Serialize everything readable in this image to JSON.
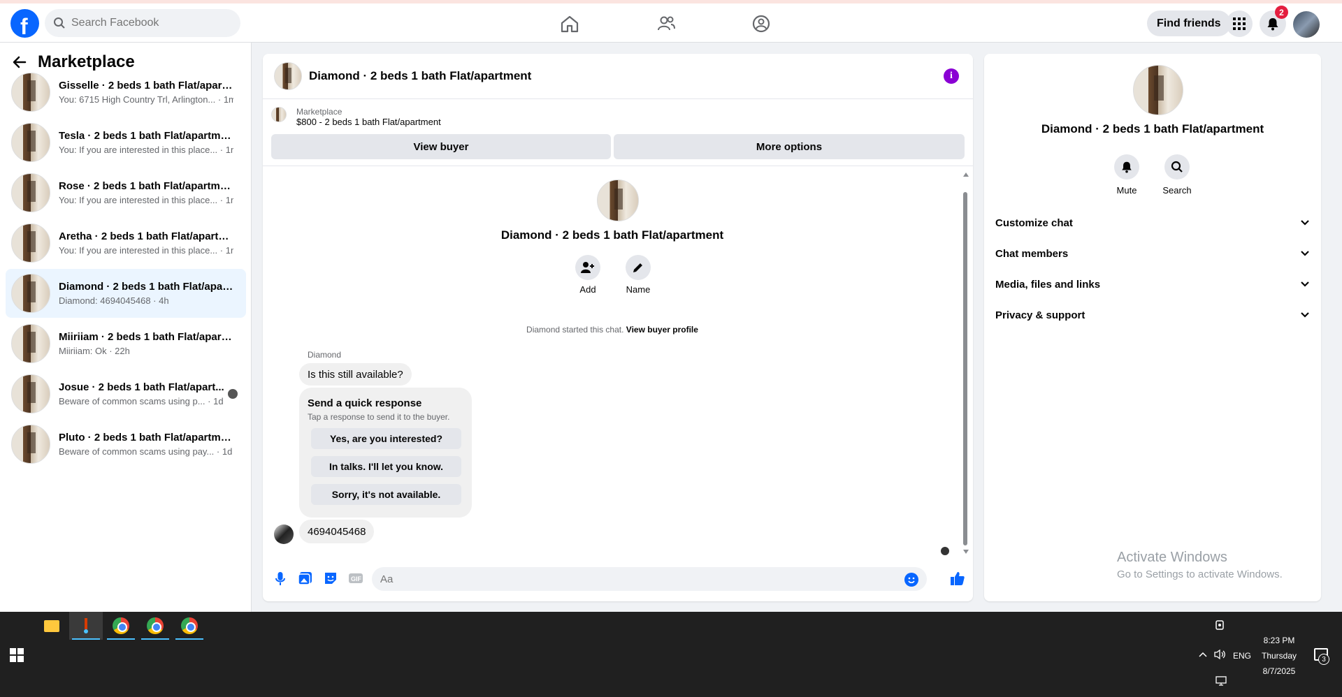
{
  "topbar": {
    "search_placeholder": "Search Facebook",
    "find_friends_label": "Find friends",
    "notifications_count": "2"
  },
  "sidebar": {
    "title": "Marketplace",
    "conversations": [
      {
        "title": "Gisselle · 2 beds 1 bath Flat/apart...",
        "subtitle": "You: 6715 High Country Trl, Arlington... · 1m"
      },
      {
        "title": "Tesla · 2 beds 1 bath Flat/apartment",
        "subtitle": "You: If you are interested in this place... · 1m"
      },
      {
        "title": "Rose · 2 beds 1 bath Flat/apartment",
        "subtitle": "You: If you are interested in this place... · 1m"
      },
      {
        "title": "Aretha · 2 beds 1 bath Flat/apartm...",
        "subtitle": "You: If you are interested in this place... · 1m"
      },
      {
        "title": "Diamond · 2 beds 1 bath Flat/apart...",
        "subtitle": "Diamond: 4694045468 · 4h"
      },
      {
        "title": "Miiriiam · 2 beds 1 bath Flat/apart...",
        "subtitle": "Miiriiam: Ok · 22h"
      },
      {
        "title": "Josue · 2 beds 1 bath Flat/apart...",
        "subtitle": "Beware of common scams using p... · 1d"
      },
      {
        "title": "Pluto · 2 beds 1 bath Flat/apartment",
        "subtitle": "Beware of common scams using pay... · 1d"
      }
    ]
  },
  "chat": {
    "title": "Diamond · 2 beds 1 bath Flat/apartment",
    "marketplace_label": "Marketplace",
    "listing": "$800 - 2 beds 1 bath Flat/apartment",
    "view_buyer": "View buyer",
    "more_options": "More options",
    "center_title": "Diamond · 2 beds 1 bath Flat/apartment",
    "add_label": "Add",
    "name_label": "Name",
    "started_text": "Diamond started this chat.",
    "view_buyer_profile": "View buyer profile",
    "sender": "Diamond",
    "message1": "Is this still available?",
    "quick_title": "Send a quick response",
    "quick_sub": "Tap a response to send it to the buyer.",
    "quick_responses": [
      "Yes, are you interested?",
      "In talks. I'll let you know.",
      "Sorry, it's not available."
    ],
    "message2": "4694045468",
    "composer_placeholder": "Aa"
  },
  "right_panel": {
    "title": "Diamond · 2 beds 1 bath Flat/apartment",
    "mute_label": "Mute",
    "search_label": "Search",
    "sections": [
      "Customize chat",
      "Chat members",
      "Media, files and links",
      "Privacy & support"
    ],
    "activate_title": "Activate Windows",
    "activate_sub": "Go to Settings to activate Windows."
  },
  "taskbar": {
    "lang": "ENG",
    "time": "8:23 PM",
    "day": "Thursday",
    "date": "8/7/2025",
    "notif_count": "3"
  },
  "colors": {
    "brand": "#0866ff",
    "badge": "#e41e3f",
    "info": "#8a00d4",
    "active_row": "#ebf5ff"
  }
}
